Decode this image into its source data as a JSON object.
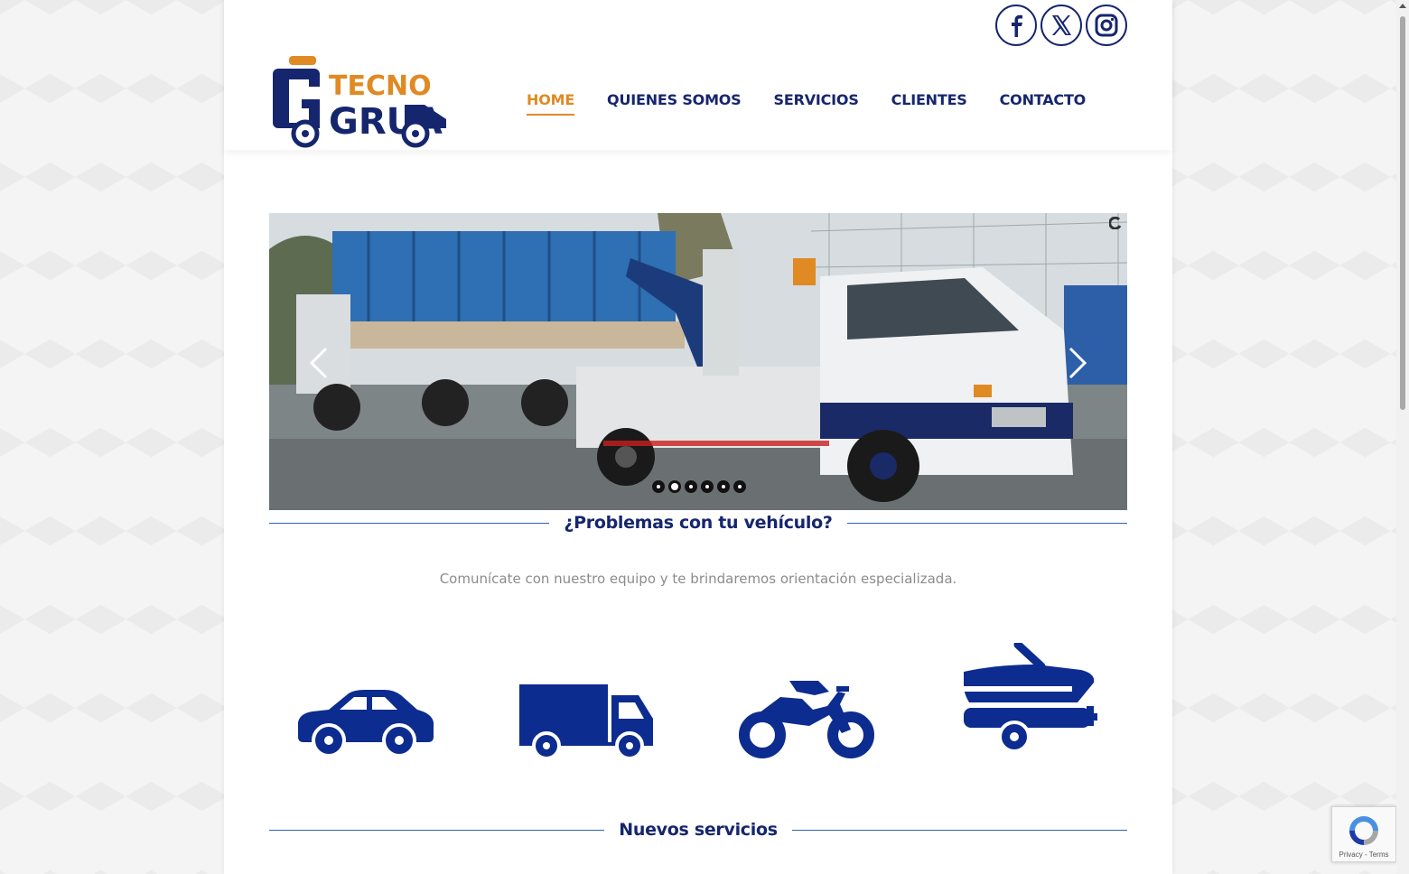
{
  "logo": {
    "line1": "TECNO",
    "line2": "GRUA"
  },
  "social": [
    {
      "name": "facebook-icon",
      "glyph": "f"
    },
    {
      "name": "x-icon",
      "glyph": "X"
    },
    {
      "name": "instagram-icon",
      "glyph": "ig"
    }
  ],
  "nav": {
    "home": "HOME",
    "quienes": "QUIENES SOMOS",
    "servicios": "SERVICIOS",
    "clientes": "CLIENTES",
    "contacto": "CONTACTO"
  },
  "slider": {
    "slide_count": 6,
    "active_slide": 2
  },
  "section1": {
    "title": "¿Problemas con tu vehículo?",
    "subtitle": "Comunícate con nuestro equipo y te brindaremos orientación especializada."
  },
  "vehicles": [
    "car-icon",
    "truck-icon",
    "motorcycle-icon",
    "boat-trailer-icon"
  ],
  "section2": {
    "title": "Nuevos servicios"
  },
  "recaptcha": {
    "terms": "Privacy - Terms"
  },
  "colors": {
    "navy": "#16266e",
    "orange": "#e08a24",
    "accent_line": "#2c64b4",
    "icon_blue": "#0d2c8f"
  }
}
